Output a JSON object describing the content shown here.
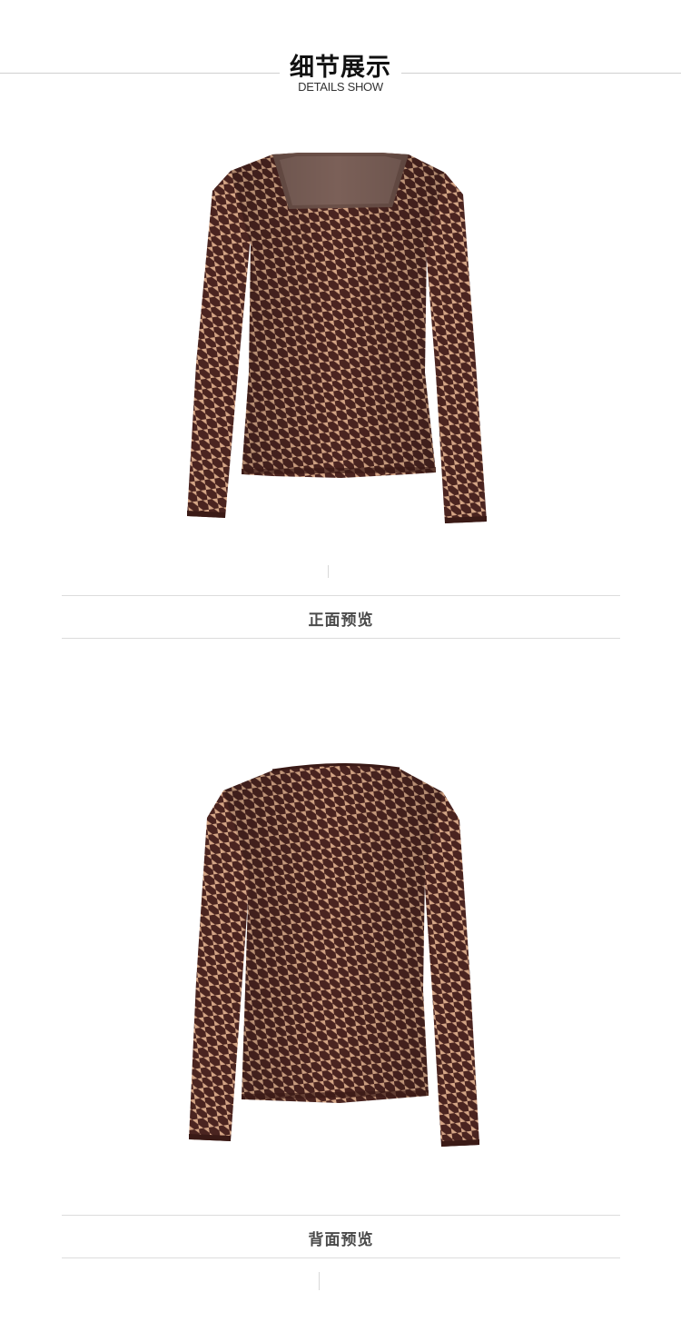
{
  "header": {
    "title": "细节展示",
    "subtitle": "DETAILS SHOW"
  },
  "front": {
    "caption": "正面预览"
  },
  "back": {
    "caption": "背面预览"
  },
  "colors": {
    "houndstooth_dark": "#4a2420",
    "houndstooth_light": "#d4a585",
    "rule": "#d0d0d0",
    "caption_text": "#4a4a4a"
  }
}
